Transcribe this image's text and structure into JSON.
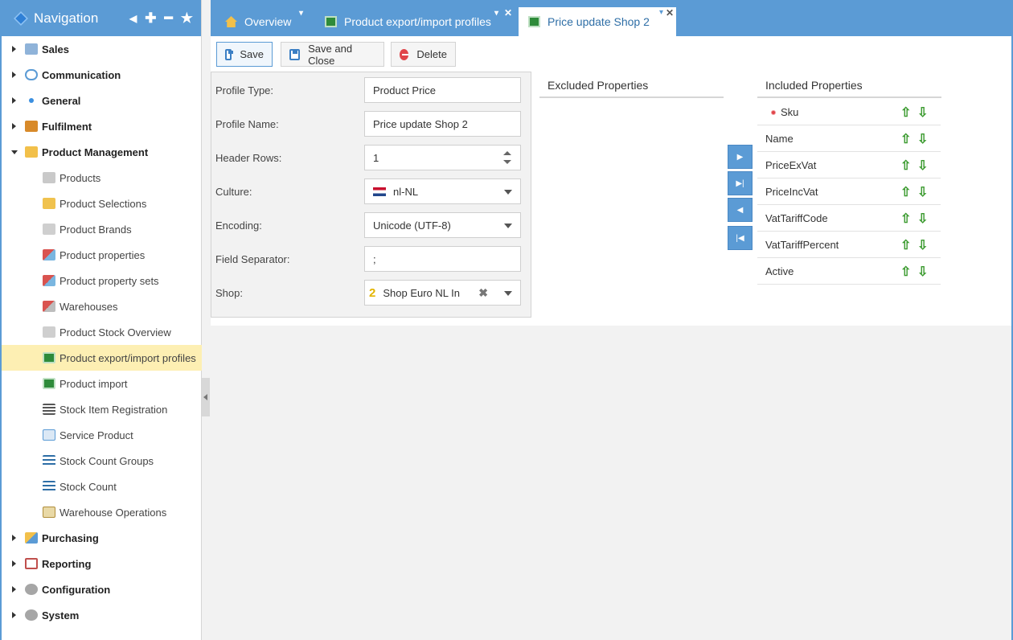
{
  "nav": {
    "title": "Navigation",
    "items": [
      {
        "label": "Sales",
        "icon": "basket-icon"
      },
      {
        "label": "Communication",
        "icon": "chat-icon"
      },
      {
        "label": "General",
        "icon": "dot-icon"
      },
      {
        "label": "Fulfilment",
        "icon": "box-icon"
      },
      {
        "label": "Product Management",
        "icon": "package-icon"
      }
    ],
    "sub_items": [
      {
        "label": "Products",
        "icon": "products-icon"
      },
      {
        "label": "Product Selections",
        "icon": "folder-icon"
      },
      {
        "label": "Product Brands",
        "icon": "brand-icon"
      },
      {
        "label": "Product properties",
        "icon": "properties-icon"
      },
      {
        "label": "Product property sets",
        "icon": "property-sets-icon"
      },
      {
        "label": "Warehouses",
        "icon": "warehouse-icon"
      },
      {
        "label": "Product Stock Overview",
        "icon": "stock-overview-icon"
      },
      {
        "label": "Product export/import profiles",
        "icon": "excel-icon"
      },
      {
        "label": "Product import",
        "icon": "excel-icon"
      },
      {
        "label": "Stock Item Registration",
        "icon": "list-icon"
      },
      {
        "label": "Service Product",
        "icon": "edit-icon"
      },
      {
        "label": "Stock Count Groups",
        "icon": "list-icon"
      },
      {
        "label": "Stock Count",
        "icon": "list-icon"
      },
      {
        "label": "Warehouse Operations",
        "icon": "clipboard-icon"
      }
    ],
    "bottom_items": [
      {
        "label": "Purchasing",
        "icon": "purchase-icon"
      },
      {
        "label": "Reporting",
        "icon": "report-icon"
      },
      {
        "label": "Configuration",
        "icon": "gear-icon"
      },
      {
        "label": "System",
        "icon": "gear-icon"
      }
    ]
  },
  "tabs": [
    {
      "label": "Overview",
      "icon": "home-icon"
    },
    {
      "label": "Product export/import profiles",
      "icon": "excel-icon"
    },
    {
      "label": "Price update Shop 2",
      "icon": "excel-icon"
    }
  ],
  "toolbar": {
    "save": "Save",
    "save_close": "Save and Close",
    "delete": "Delete"
  },
  "form": {
    "profile_type": {
      "label": "Profile Type:",
      "value": "Product Price"
    },
    "profile_name": {
      "label": "Profile Name:",
      "value": "Price update Shop 2"
    },
    "header_rows": {
      "label": "Header Rows:",
      "value": "1"
    },
    "culture": {
      "label": "Culture:",
      "value": "nl-NL"
    },
    "encoding": {
      "label": "Encoding:",
      "value": "Unicode (UTF-8)"
    },
    "field_separator": {
      "label": "Field Separator:",
      "value": ";"
    },
    "shop": {
      "label": "Shop:",
      "value": "Shop Euro NL In",
      "badge": "2"
    }
  },
  "excluded": {
    "title": "Excluded Properties"
  },
  "included": {
    "title": "Included Properties",
    "items": [
      "Sku",
      "Name",
      "PriceExVat",
      "PriceIncVat",
      "VatTariffCode",
      "VatTariffPercent",
      "Active"
    ]
  },
  "colors": {
    "header_blue": "#5b9bd5",
    "active_row": "#fdefb3",
    "arrow_green": "#3a9a2e"
  }
}
